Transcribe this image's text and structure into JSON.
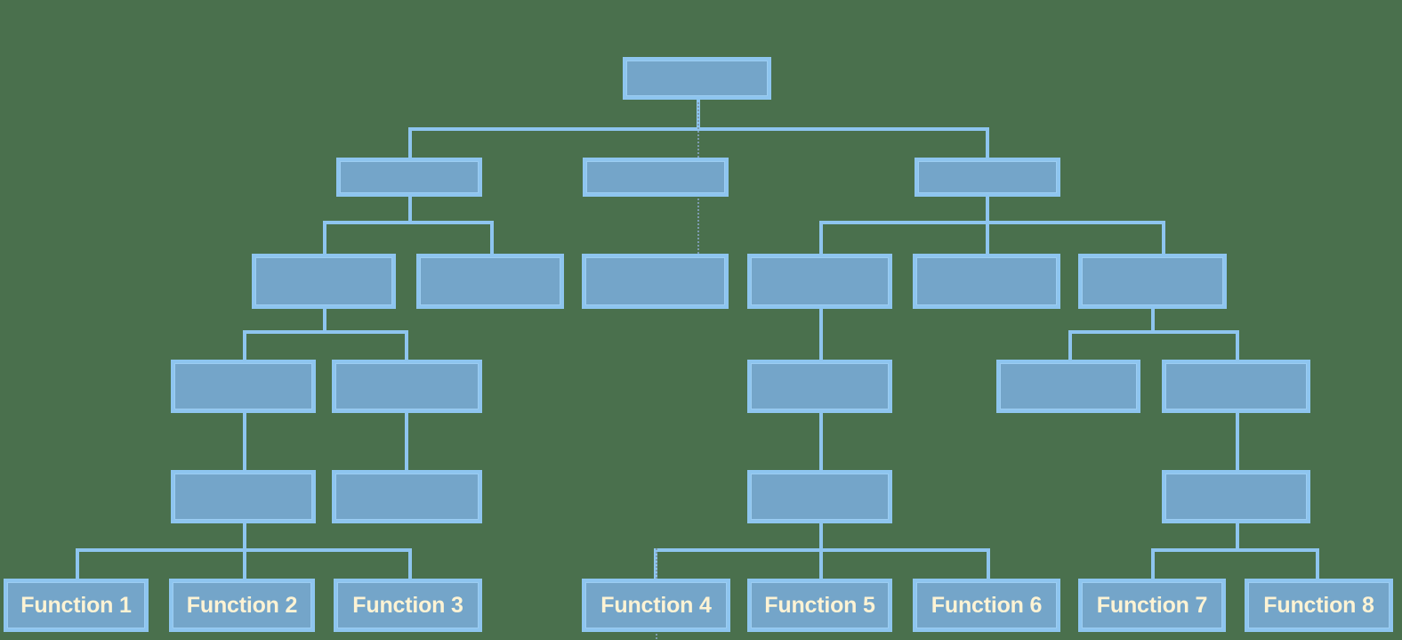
{
  "diagram": {
    "type": "organizational-hierarchy-tree",
    "title": "",
    "background_color": "#4a704d",
    "node_fill_color": "#74a5c9",
    "node_border_color": "#8ec5ef",
    "connector_color": "#8ec5ef",
    "label_color": "#fdf3d4",
    "levels": 6,
    "nodes": [
      {
        "id": "n0",
        "level": 1,
        "label": ""
      },
      {
        "id": "n1",
        "level": 2,
        "label": ""
      },
      {
        "id": "n2",
        "level": 2,
        "label": ""
      },
      {
        "id": "n3",
        "level": 2,
        "label": ""
      },
      {
        "id": "n4",
        "level": 3,
        "label": ""
      },
      {
        "id": "n5",
        "level": 3,
        "label": ""
      },
      {
        "id": "n6",
        "level": 3,
        "label": ""
      },
      {
        "id": "n7",
        "level": 3,
        "label": ""
      },
      {
        "id": "n8",
        "level": 3,
        "label": ""
      },
      {
        "id": "n9",
        "level": 3,
        "label": ""
      },
      {
        "id": "n10",
        "level": 4,
        "label": ""
      },
      {
        "id": "n11",
        "level": 4,
        "label": ""
      },
      {
        "id": "n12",
        "level": 4,
        "label": ""
      },
      {
        "id": "n13",
        "level": 4,
        "label": ""
      },
      {
        "id": "n14",
        "level": 4,
        "label": ""
      },
      {
        "id": "n15",
        "level": 5,
        "label": ""
      },
      {
        "id": "n16",
        "level": 5,
        "label": ""
      },
      {
        "id": "n17",
        "level": 5,
        "label": ""
      },
      {
        "id": "n18",
        "level": 5,
        "label": ""
      },
      {
        "id": "f1",
        "level": 6,
        "label": "Function 1"
      },
      {
        "id": "f2",
        "level": 6,
        "label": "Function 2"
      },
      {
        "id": "f3",
        "level": 6,
        "label": "Function 3"
      },
      {
        "id": "f4",
        "level": 6,
        "label": "Function 4"
      },
      {
        "id": "f5",
        "level": 6,
        "label": "Function 5"
      },
      {
        "id": "f6",
        "level": 6,
        "label": "Function 6"
      },
      {
        "id": "f7",
        "level": 6,
        "label": "Function 7"
      },
      {
        "id": "f8",
        "level": 6,
        "label": "Function 8"
      }
    ],
    "leaf_labels": [
      "Function 1",
      "Function 2",
      "Function 3",
      "Function 4",
      "Function 5",
      "Function 6",
      "Function 7",
      "Function 8"
    ]
  }
}
